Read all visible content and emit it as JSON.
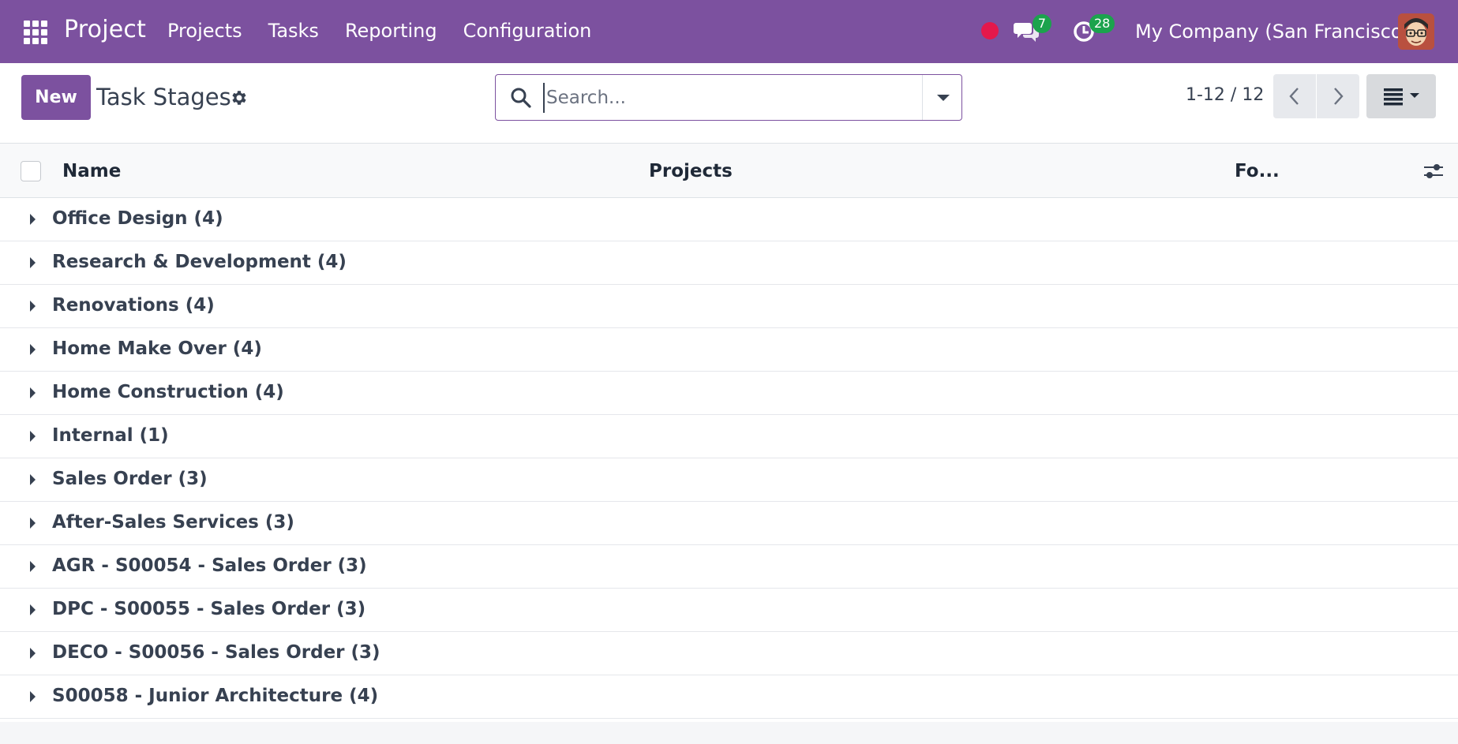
{
  "navbar": {
    "app_name": "Project",
    "menu": [
      {
        "label": "Projects"
      },
      {
        "label": "Tasks"
      },
      {
        "label": "Reporting"
      },
      {
        "label": "Configuration"
      }
    ],
    "status_dot_color": "#e4184b",
    "messages_count": "7",
    "activities_count": "28",
    "company": "My Company (San Francisco)",
    "brand_color": "#7c519f",
    "badge_color": "#1ba34d"
  },
  "control_panel": {
    "new_label": "New",
    "title": "Task Stages",
    "search_placeholder": "Search...",
    "pager": "1-12 / 12"
  },
  "list": {
    "columns": [
      {
        "label": "Name"
      },
      {
        "label": "Projects"
      },
      {
        "label": "Fo..."
      }
    ],
    "groups": [
      {
        "label": "Office Design (4)"
      },
      {
        "label": "Research & Development (4)"
      },
      {
        "label": "Renovations (4)"
      },
      {
        "label": "Home Make Over (4)"
      },
      {
        "label": "Home Construction (4)"
      },
      {
        "label": "Internal (1)"
      },
      {
        "label": "Sales Order (3)"
      },
      {
        "label": "After-Sales Services (3)"
      },
      {
        "label": "AGR - S00054 - Sales Order (3)"
      },
      {
        "label": "DPC - S00055 - Sales Order (3)"
      },
      {
        "label": "DECO - S00056 - Sales Order (3)"
      },
      {
        "label": "S00058 - Junior Architecture (4)"
      }
    ]
  },
  "icons": {
    "apps": "apps-grid-icon",
    "chat": "chat-bubbles-icon",
    "activity": "clock-activity-icon",
    "gear": "gear-icon",
    "search": "search-icon",
    "prev": "chevron-left-icon",
    "next": "chevron-right-icon",
    "view": "list-view-icon",
    "column_settings": "sliders-icon"
  }
}
